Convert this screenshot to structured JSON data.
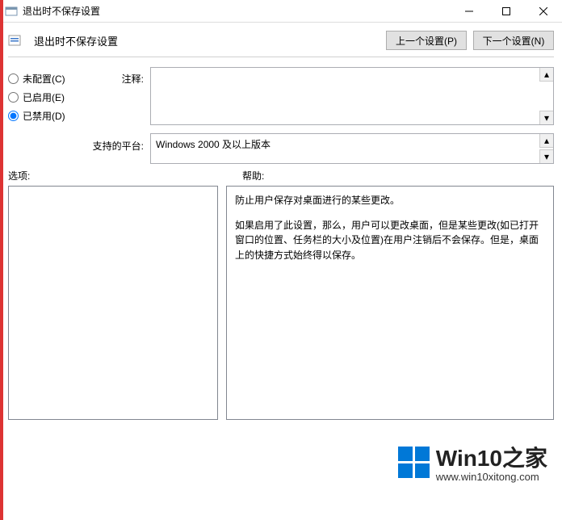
{
  "window": {
    "title": "退出时不保存设置"
  },
  "header": {
    "policy_title": "退出时不保存设置",
    "prev_label": "上一个设置(P)",
    "next_label": "下一个设置(N)"
  },
  "radios": {
    "not_configured": "未配置(C)",
    "enabled": "已启用(E)",
    "disabled": "已禁用(D)",
    "selected": "disabled"
  },
  "labels": {
    "comment": "注释:",
    "platform": "支持的平台:",
    "options": "选项:",
    "help": "帮助:"
  },
  "fields": {
    "comment_value": "",
    "platform_value": "Windows 2000 及以上版本"
  },
  "help": {
    "p1": "防止用户保存对桌面进行的某些更改。",
    "p2": "如果启用了此设置，那么，用户可以更改桌面，但是某些更改(如已打开窗口的位置、任务栏的大小及位置)在用户注销后不会保存。但是，桌面上的快捷方式始终得以保存。"
  },
  "watermark": {
    "brand": "Win10",
    "sub": "之家",
    "url": "www.win10xitong.com"
  }
}
